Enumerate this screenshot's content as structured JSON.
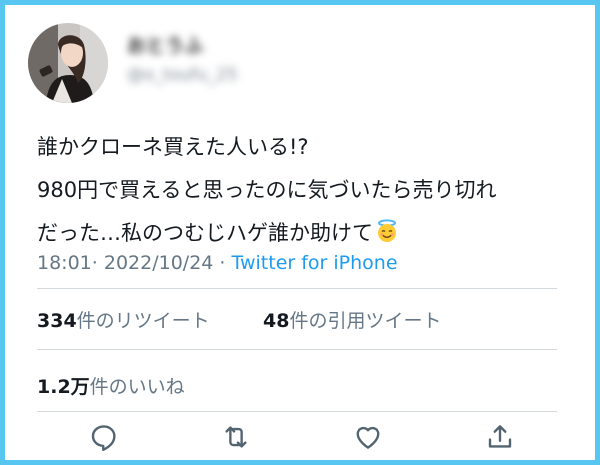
{
  "user": {
    "display_name": "おとうふ",
    "handle": "@o_toufu_25"
  },
  "tweet": {
    "lines": [
      "誰かクローネ買えた人いる!?",
      "980円で買えると思ったのに気づいたら売り切れ",
      "だった…私のつむじハゲ誰か助けて"
    ],
    "emoji": "smiling-face-with-halo"
  },
  "meta": {
    "time": "18:01",
    "separator": "·",
    "date": "2022/10/24",
    "source": "Twitter for iPhone"
  },
  "stats": {
    "retweets_count": "334",
    "retweets_label": "件のリツイート",
    "quotes_count": "48",
    "quotes_label": "件の引用ツイート",
    "likes_count": "1.2万",
    "likes_label": "件のいいね"
  },
  "actions": [
    "reply-icon",
    "retweet-icon",
    "like-icon",
    "share-icon"
  ],
  "colors": {
    "border": "#57c7f2",
    "link": "#1d9bf0",
    "secondary_text": "#657786",
    "action_icon": "#536471"
  }
}
